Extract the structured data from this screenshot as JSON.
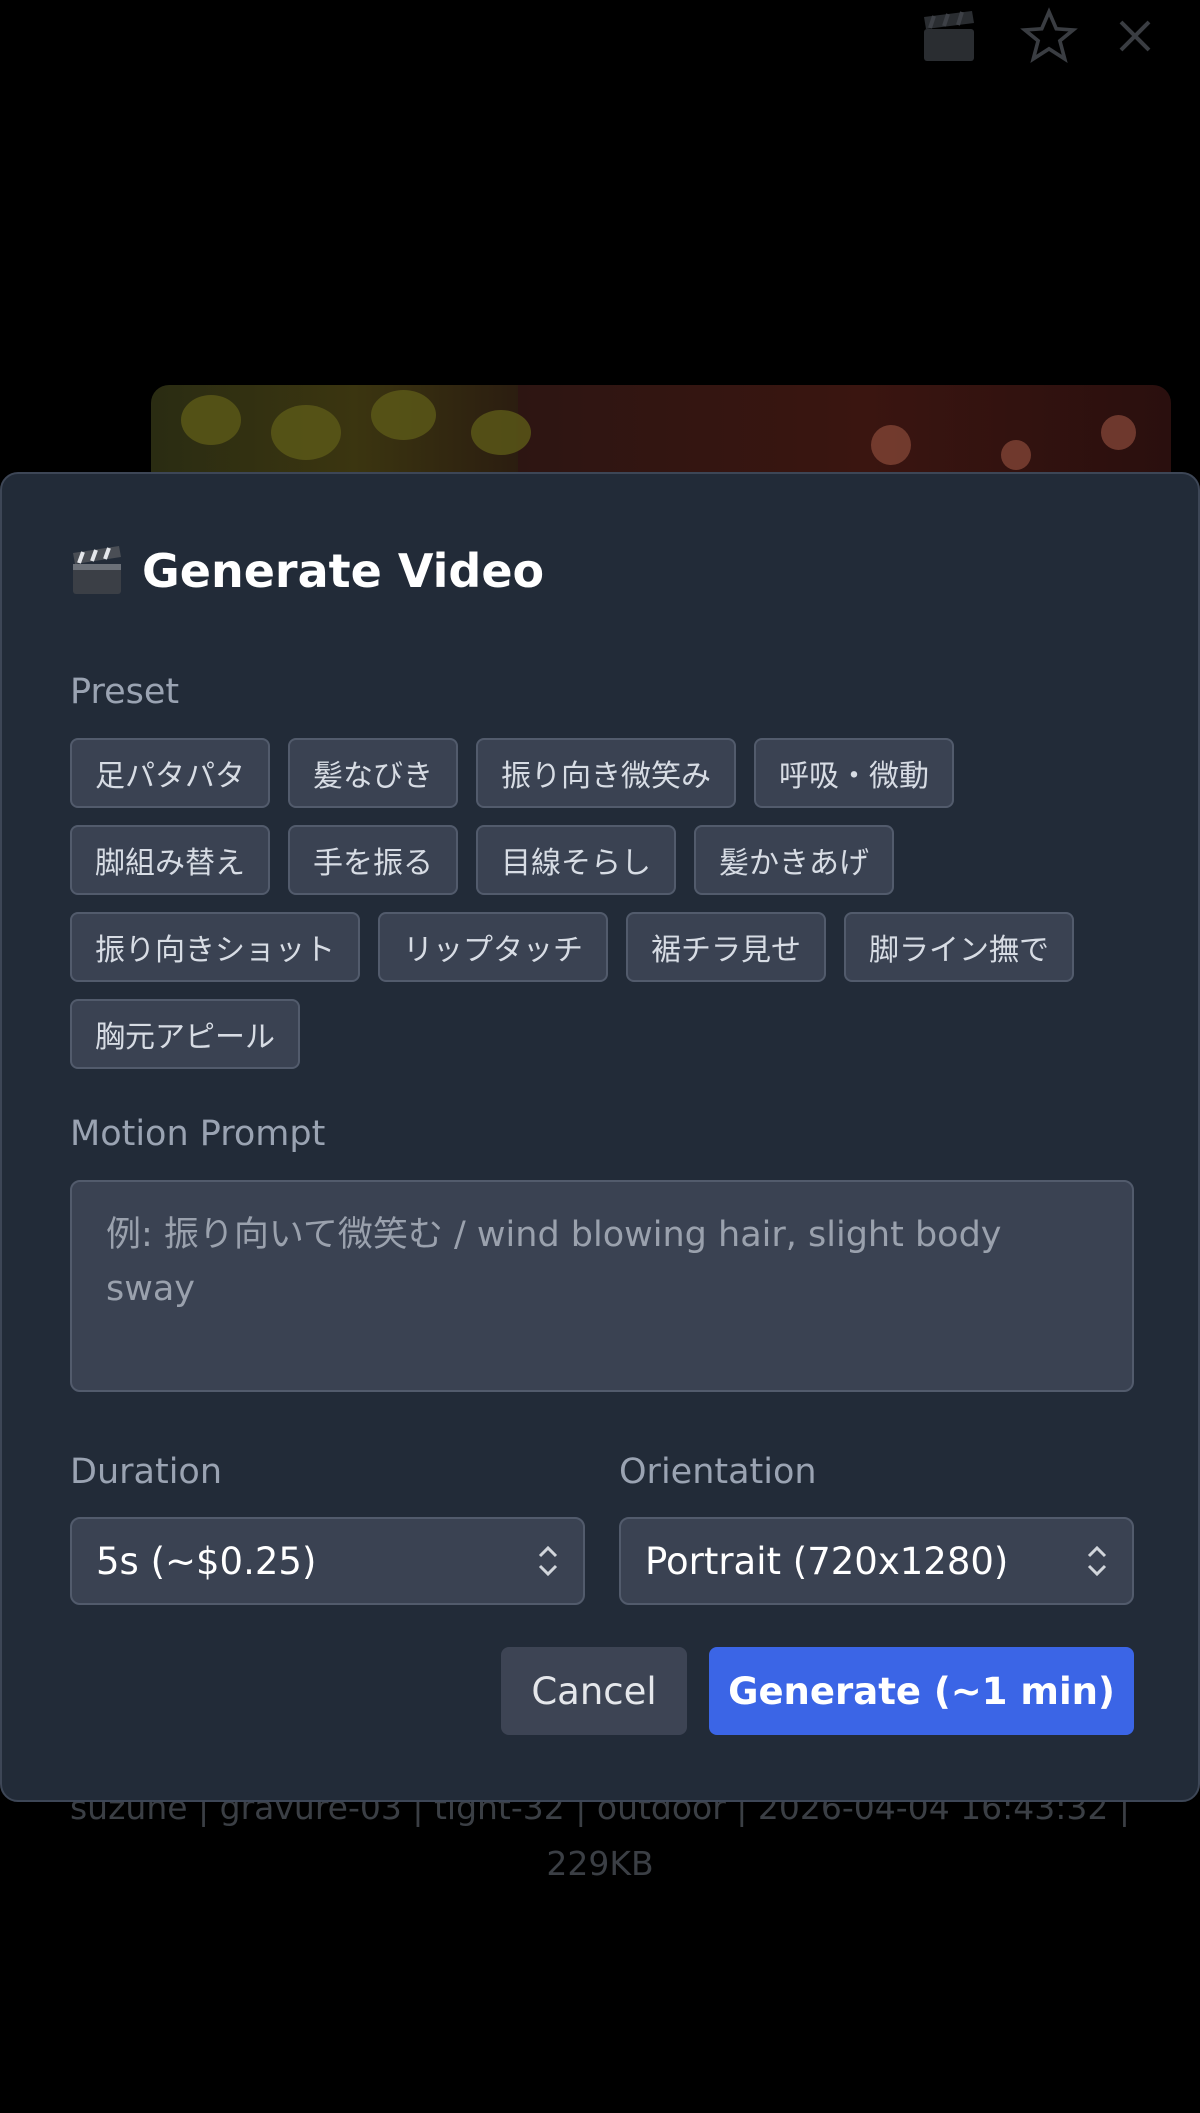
{
  "topbar": {
    "icons": [
      "clapperboard-icon",
      "star-icon",
      "close-icon"
    ]
  },
  "background": {
    "meta_line1": "suzune | gravure-03 | tight-32 | outdoor | 2026-04-04 16:43:32 |",
    "meta_line2": "229KB"
  },
  "modal": {
    "title": "Generate Video",
    "title_icon": "clapperboard-icon",
    "preset_label": "Preset",
    "presets": [
      "足パタパタ",
      "髪なびき",
      "振り向き微笑み",
      "呼吸・微動",
      "脚組み替え",
      "手を振る",
      "目線そらし",
      "髪かきあげ",
      "振り向きショット",
      "リップタッチ",
      "裾チラ見せ",
      "脚ライン撫で",
      "胸元アピール"
    ],
    "motion_label": "Motion Prompt",
    "motion_placeholder": "例: 振り向いて微笑む / wind blowing hair, slight body sway",
    "motion_value": "",
    "duration_label": "Duration",
    "duration_value": "5s (~$0.25)",
    "orientation_label": "Orientation",
    "orientation_value": "Portrait (720x1280)",
    "cancel_label": "Cancel",
    "generate_label": "Generate (~1 min)"
  },
  "colors": {
    "modal_bg": "#222b38",
    "accent": "#3b65e6",
    "chip_bg": "#3a4252"
  }
}
